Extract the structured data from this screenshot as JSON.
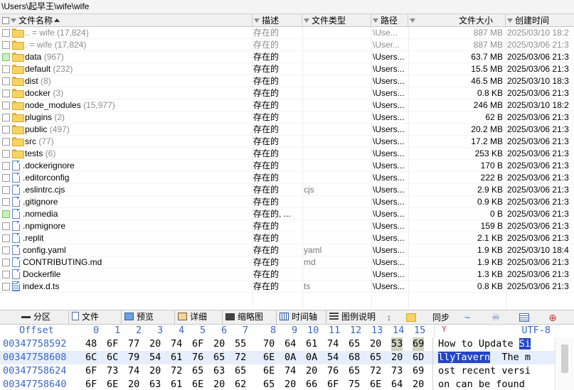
{
  "path": "\\Users\\起早王\\wife\\wife",
  "columns": {
    "name": "文件名称",
    "desc": "描述",
    "type": "文件类型",
    "path": "路径",
    "size": "文件大小",
    "created": "创建时间"
  },
  "files": [
    {
      "icon": "folder",
      "name": "..   =    wife",
      "count": "(17,824)",
      "desc": "存在的",
      "type": "",
      "path": "\\Use...",
      "size": "887 MB",
      "date": "2025/03/10",
      "time": "18:2",
      "dim": true,
      "check": ""
    },
    {
      "icon": "folder",
      "name": ".    =    wife",
      "count": "(17,824)",
      "desc": "存在的",
      "type": "",
      "path": "\\User...",
      "size": "887 MB",
      "date": "2025/03/06",
      "time": "21:3",
      "dim": true,
      "check": ""
    },
    {
      "icon": "folder",
      "name": "data",
      "count": "(967)",
      "desc": "存在的",
      "type": "",
      "path": "\\Users...",
      "size": "63.7 MB",
      "date": "2025/03/06",
      "time": "21:3",
      "dim": false,
      "check": "green"
    },
    {
      "icon": "folder",
      "name": "default",
      "count": "(232)",
      "desc": "存在的",
      "type": "",
      "path": "\\Users...",
      "size": "15.5 MB",
      "date": "2025/03/06",
      "time": "21:3",
      "dim": false,
      "check": ""
    },
    {
      "icon": "folder",
      "name": "dist",
      "count": "(8)",
      "desc": "存在的",
      "type": "",
      "path": "\\Users...",
      "size": "46.5 MB",
      "date": "2025/03/10",
      "time": "18:3",
      "dim": false,
      "check": ""
    },
    {
      "icon": "folder",
      "name": "docker",
      "count": "(3)",
      "desc": "存在的",
      "type": "",
      "path": "\\Users...",
      "size": "0.8 KB",
      "date": "2025/03/06",
      "time": "21:3",
      "dim": false,
      "check": ""
    },
    {
      "icon": "folder",
      "name": "node_modules",
      "count": "(15,977)",
      "desc": "存在的",
      "type": "",
      "path": "\\Users...",
      "size": "246 MB",
      "date": "2025/03/10",
      "time": "18:2",
      "dim": false,
      "check": ""
    },
    {
      "icon": "folder",
      "name": "plugins",
      "count": "(2)",
      "desc": "存在的",
      "type": "",
      "path": "\\Users...",
      "size": "62 B",
      "date": "2025/03/06",
      "time": "21:3",
      "dim": false,
      "check": ""
    },
    {
      "icon": "folder",
      "name": "public",
      "count": "(497)",
      "desc": "存在的",
      "type": "",
      "path": "\\Users...",
      "size": "20.2 MB",
      "date": "2025/03/06",
      "time": "21:3",
      "dim": false,
      "check": ""
    },
    {
      "icon": "folder",
      "name": "src",
      "count": "(77)",
      "desc": "存在的",
      "type": "",
      "path": "\\Users...",
      "size": "17.2 MB",
      "date": "2025/03/06",
      "time": "21:3",
      "dim": false,
      "check": ""
    },
    {
      "icon": "folder",
      "name": "tests",
      "count": "(6)",
      "desc": "存在的",
      "type": "",
      "path": "\\Users...",
      "size": "253 KB",
      "date": "2025/03/06",
      "time": "21:3",
      "dim": false,
      "check": ""
    },
    {
      "icon": "file",
      "name": ".dockerignore",
      "count": "",
      "desc": "存在的",
      "type": "",
      "path": "\\Users...",
      "size": "170 B",
      "date": "2025/03/06",
      "time": "21:3",
      "dim": false,
      "check": ""
    },
    {
      "icon": "file",
      "name": ".editorconfig",
      "count": "",
      "desc": "存在的",
      "type": "",
      "path": "\\Users...",
      "size": "222 B",
      "date": "2025/03/06",
      "time": "21:3",
      "dim": false,
      "check": ""
    },
    {
      "icon": "file",
      "name": ".eslintrc.cjs",
      "count": "",
      "desc": "存在的",
      "type": "cjs",
      "path": "\\Users...",
      "size": "2.9 KB",
      "date": "2025/03/06",
      "time": "21:3",
      "dim": false,
      "check": ""
    },
    {
      "icon": "file",
      "name": ".gitignore",
      "count": "",
      "desc": "存在的",
      "type": "",
      "path": "\\Users...",
      "size": "0.9 KB",
      "date": "2025/03/06",
      "time": "21:3",
      "dim": false,
      "check": ""
    },
    {
      "icon": "file",
      "name": ".nomedia",
      "count": "",
      "desc": "存在的, ...",
      "type": "",
      "path": "\\Users...",
      "size": "0 B",
      "date": "2025/03/06",
      "time": "21:3",
      "dim": false,
      "check": "green"
    },
    {
      "icon": "file",
      "name": ".npmignore",
      "count": "",
      "desc": "存在的",
      "type": "",
      "path": "\\Users...",
      "size": "159 B",
      "date": "2025/03/06",
      "time": "21:3",
      "dim": false,
      "check": ""
    },
    {
      "icon": "file",
      "name": ".replit",
      "count": "",
      "desc": "存在的",
      "type": "",
      "path": "\\Users...",
      "size": "2.1 KB",
      "date": "2025/03/06",
      "time": "21:3",
      "dim": false,
      "check": ""
    },
    {
      "icon": "file",
      "name": "config.yaml",
      "count": "",
      "desc": "存在的",
      "type": "yaml",
      "path": "\\Users...",
      "size": "1.9 KB",
      "date": "2025/03/10",
      "time": "18:4",
      "dim": false,
      "check": ""
    },
    {
      "icon": "file",
      "name": "CONTRIBUTING.md",
      "count": "",
      "desc": "存在的",
      "type": "md",
      "path": "\\Users...",
      "size": "1.9 KB",
      "date": "2025/03/06",
      "time": "21:3",
      "dim": false,
      "check": ""
    },
    {
      "icon": "file",
      "name": "Dockerfile",
      "count": "",
      "desc": "存在的",
      "type": "",
      "path": "\\Users...",
      "size": "1.3 KB",
      "date": "2025/03/06",
      "time": "21:3",
      "dim": false,
      "check": ""
    },
    {
      "icon": "ts",
      "name": "index.d.ts",
      "count": "",
      "desc": "存在的",
      "type": "ts",
      "path": "\\Users...",
      "size": "0.8 KB",
      "date": "2025/03/06",
      "time": "21:3",
      "dim": false,
      "check": ""
    }
  ],
  "tabs": {
    "split": "分区",
    "file": "文件",
    "preview": "预览",
    "details": "详细",
    "thumbnails": "缩略图",
    "timeline": "时间轴",
    "legend": "图例说明",
    "sync": "同步"
  },
  "hex": {
    "offset_label": "Offset",
    "columns": [
      "0",
      "1",
      "2",
      "3",
      "4",
      "5",
      "6",
      "7",
      "8",
      "9",
      "10",
      "11",
      "12",
      "13",
      "14",
      "15"
    ],
    "encoding": "UTF-8",
    "encoding_marker": "Y",
    "rows": [
      {
        "offset": "00347758592",
        "bytes": [
          "48",
          "6F",
          "77",
          "20",
          "74",
          "6F",
          "20",
          "55",
          "70",
          "64",
          "61",
          "74",
          "65",
          "20",
          "53",
          "69"
        ]
      },
      {
        "offset": "00347758608",
        "bytes": [
          "6C",
          "6C",
          "79",
          "54",
          "61",
          "76",
          "65",
          "72",
          "6E",
          "0A",
          "0A",
          "54",
          "68",
          "65",
          "20",
          "6D"
        ]
      },
      {
        "offset": "00347758624",
        "bytes": [
          "6F",
          "73",
          "74",
          "20",
          "72",
          "65",
          "63",
          "65",
          "6E",
          "74",
          "20",
          "76",
          "65",
          "72",
          "73",
          "69"
        ]
      },
      {
        "offset": "00347758640",
        "bytes": [
          "6F",
          "6E",
          "20",
          "63",
          "61",
          "6E",
          "20",
          "62",
          "65",
          "20",
          "66",
          "6F",
          "75",
          "6E",
          "64",
          "20"
        ]
      }
    ],
    "text": [
      {
        "before": "How to Update ",
        "sel": "Si",
        "after": ""
      },
      {
        "before": "",
        "sel": "llyTavern",
        "after": "  The m"
      },
      {
        "before": "ost recent versi",
        "sel": "",
        "after": ""
      },
      {
        "before": "on can be found ",
        "sel": "",
        "after": ""
      }
    ]
  }
}
